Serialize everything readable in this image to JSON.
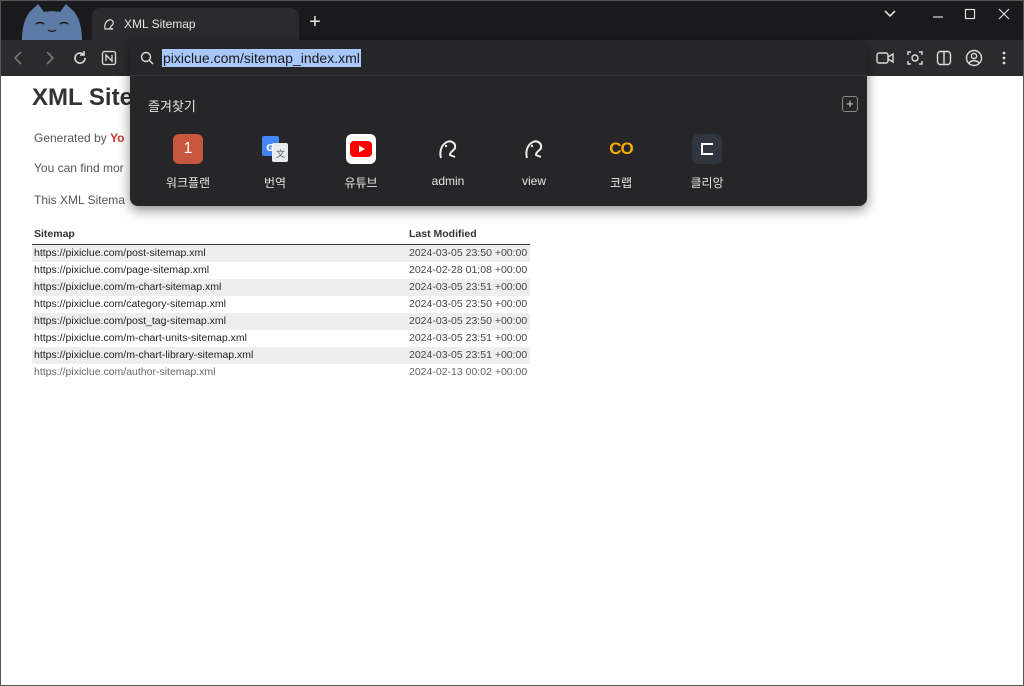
{
  "tab": {
    "title": "XML Sitemap"
  },
  "omnibox": {
    "url": "pixiclue.com/sitemap_index.xml",
    "favorites_title": "즐겨찾기",
    "shortcuts": [
      {
        "label": "워크플랜",
        "icon": "workplan-icon",
        "color": "#c8553d",
        "glyph": "1"
      },
      {
        "label": "번역",
        "icon": "google-translate-icon",
        "color": "#4285f4",
        "glyph": "G"
      },
      {
        "label": "유튜브",
        "icon": "youtube-icon",
        "color": "#ff0000",
        "glyph": ""
      },
      {
        "label": "admin",
        "icon": "squirrel-icon",
        "color": "#262628",
        "glyph": ""
      },
      {
        "label": "view",
        "icon": "squirrel-icon",
        "color": "#262628",
        "glyph": ""
      },
      {
        "label": "코랩",
        "icon": "colab-icon",
        "color": "#f9ab00",
        "glyph": "CO"
      },
      {
        "label": "클리앙",
        "icon": "clien-icon",
        "color": "#2f3640",
        "glyph": ""
      }
    ]
  },
  "page": {
    "title": "XML Site",
    "generated_prefix": "Generated by ",
    "generated_link": "Yo",
    "find_more": "You can find mor",
    "this_xml": "This XML Sitema",
    "table": {
      "headers": [
        "Sitemap",
        "Last Modified"
      ],
      "rows": [
        [
          "https://pixiclue.com/post-sitemap.xml",
          "2024-03-05 23:50 +00:00"
        ],
        [
          "https://pixiclue.com/page-sitemap.xml",
          "2024-02-28 01:08 +00:00"
        ],
        [
          "https://pixiclue.com/m-chart-sitemap.xml",
          "2024-03-05 23:51 +00:00"
        ],
        [
          "https://pixiclue.com/category-sitemap.xml",
          "2024-03-05 23:50 +00:00"
        ],
        [
          "https://pixiclue.com/post_tag-sitemap.xml",
          "2024-03-05 23:50 +00:00"
        ],
        [
          "https://pixiclue.com/m-chart-units-sitemap.xml",
          "2024-03-05 23:51 +00:00"
        ],
        [
          "https://pixiclue.com/m-chart-library-sitemap.xml",
          "2024-03-05 23:51 +00:00"
        ],
        [
          "https://pixiclue.com/author-sitemap.xml",
          "2024-02-13 00:02 +00:00"
        ]
      ]
    }
  }
}
